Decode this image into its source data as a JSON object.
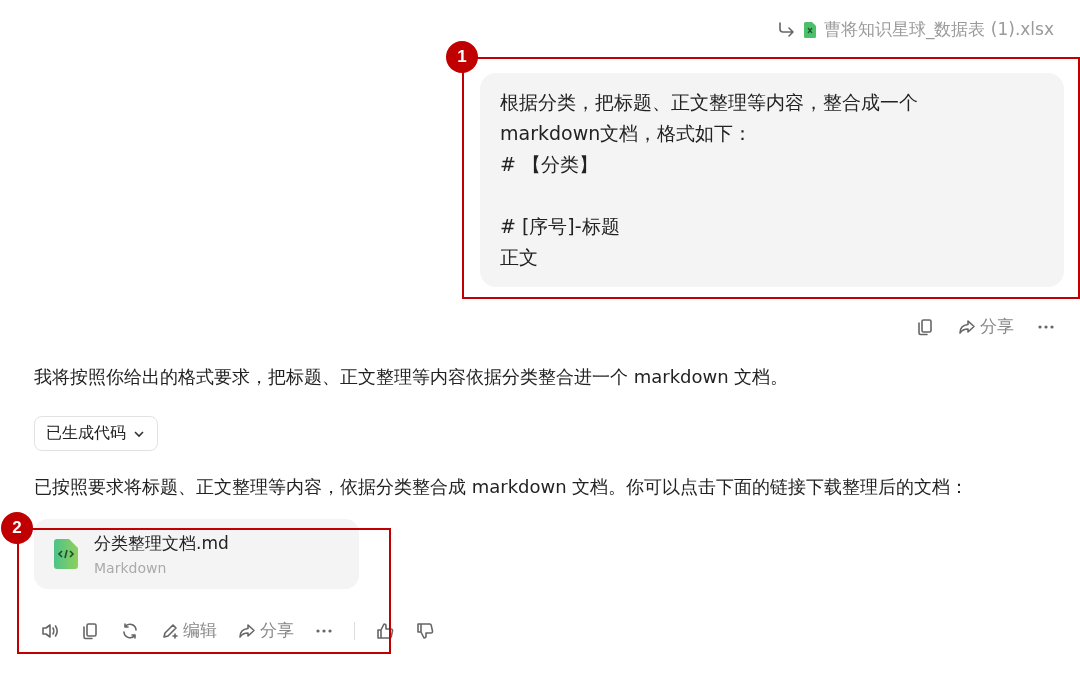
{
  "attachment": {
    "name": "曹将知识星球_数据表 (1).xlsx"
  },
  "user_message": {
    "blocks": [
      [
        "根据分类，把标题、正文整理等内容，整合成一个markdown文档，格式如下：",
        "# 【分类】"
      ],
      [
        "# [序号]-标题",
        "正文"
      ]
    ]
  },
  "user_actions": {
    "share": "分享"
  },
  "reply": {
    "intro": "我将按照你给出的格式要求，把标题、正文整理等内容依据分类整合进一个 markdown 文档。",
    "code_toggle": {
      "label": "已生成代码",
      "expanded": false
    },
    "summary": "已按照要求将标题、正文整理等内容，依据分类整合成 markdown 文档。你可以点击下面的链接下载整理后的文档：",
    "file": {
      "name": "分类整理文档.md",
      "type": "Markdown"
    }
  },
  "reply_actions": {
    "edit": "编辑",
    "share": "分享"
  },
  "annotations": [
    {
      "number": "1"
    },
    {
      "number": "2"
    }
  ]
}
